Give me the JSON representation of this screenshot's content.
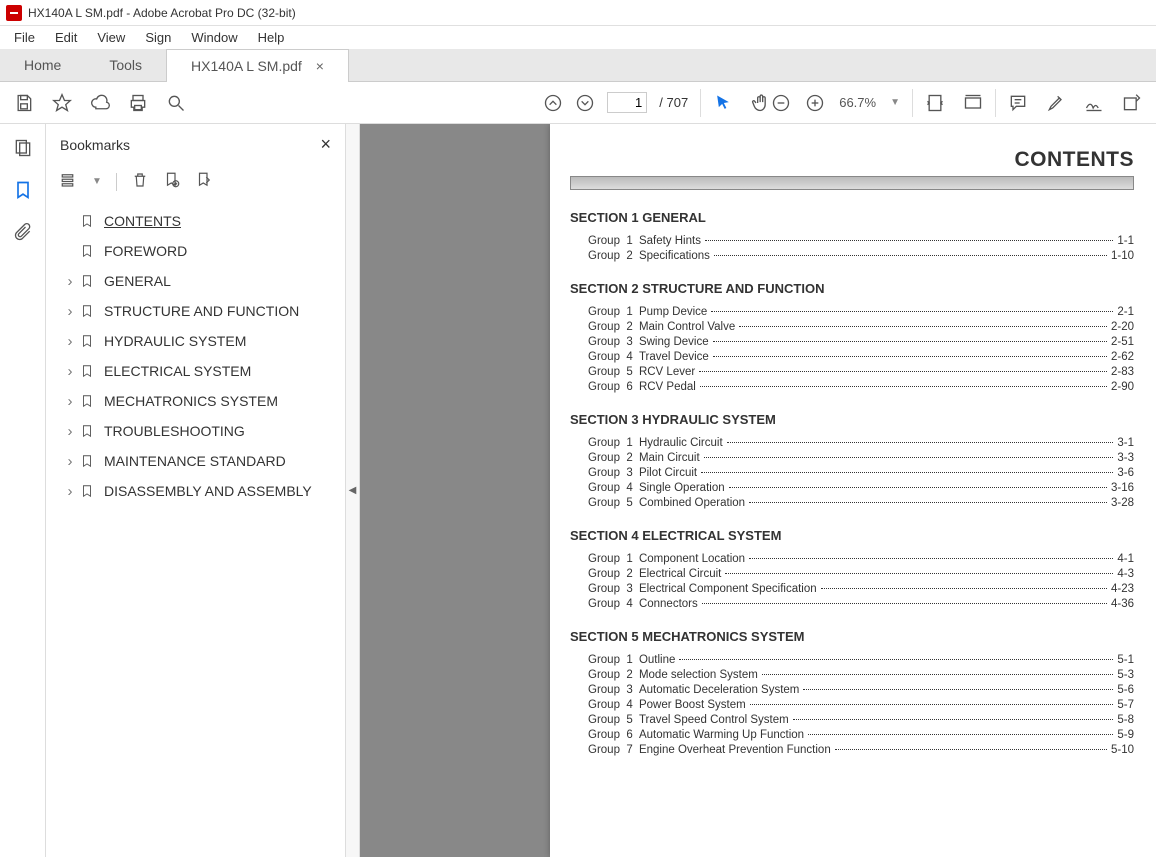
{
  "window": {
    "title": "HX140A L SM.pdf - Adobe Acrobat Pro DC (32-bit)"
  },
  "menu": {
    "items": [
      "File",
      "Edit",
      "View",
      "Sign",
      "Window",
      "Help"
    ]
  },
  "tabs": {
    "home": "Home",
    "tools": "Tools",
    "doc": "HX140A L SM.pdf"
  },
  "toolbar": {
    "current_page": "1",
    "total_pages": "707",
    "zoom": "66.7%"
  },
  "sidepanel": {
    "title": "Bookmarks",
    "items": [
      {
        "label": "CONTENTS",
        "expandable": false,
        "selected": true
      },
      {
        "label": "FOREWORD",
        "expandable": false,
        "selected": false
      },
      {
        "label": "GENERAL",
        "expandable": true,
        "selected": false
      },
      {
        "label": "STRUCTURE AND FUNCTION",
        "expandable": true,
        "selected": false
      },
      {
        "label": "HYDRAULIC SYSTEM",
        "expandable": true,
        "selected": false
      },
      {
        "label": "ELECTRICAL SYSTEM",
        "expandable": true,
        "selected": false
      },
      {
        "label": "MECHATRONICS SYSTEM",
        "expandable": true,
        "selected": false
      },
      {
        "label": "TROUBLESHOOTING",
        "expandable": true,
        "selected": false
      },
      {
        "label": "MAINTENANCE STANDARD",
        "expandable": true,
        "selected": false
      },
      {
        "label": "DISASSEMBLY AND ASSEMBLY",
        "expandable": true,
        "selected": false
      }
    ]
  },
  "doc": {
    "title": "CONTENTS",
    "sections": [
      {
        "num": "1",
        "name": "GENERAL",
        "groups": [
          {
            "n": "1",
            "name": "Safety Hints",
            "page": "1-1"
          },
          {
            "n": "2",
            "name": "Specifications",
            "page": "1-10"
          }
        ]
      },
      {
        "num": "2",
        "name": "STRUCTURE AND FUNCTION",
        "groups": [
          {
            "n": "1",
            "name": "Pump Device",
            "page": "2-1"
          },
          {
            "n": "2",
            "name": "Main Control Valve",
            "page": "2-20"
          },
          {
            "n": "3",
            "name": "Swing Device",
            "page": "2-51"
          },
          {
            "n": "4",
            "name": "Travel Device",
            "page": "2-62"
          },
          {
            "n": "5",
            "name": "RCV Lever",
            "page": "2-83"
          },
          {
            "n": "6",
            "name": "RCV Pedal",
            "page": "2-90"
          }
        ]
      },
      {
        "num": "3",
        "name": "HYDRAULIC SYSTEM",
        "groups": [
          {
            "n": "1",
            "name": "Hydraulic Circuit",
            "page": "3-1"
          },
          {
            "n": "2",
            "name": "Main Circuit",
            "page": "3-3"
          },
          {
            "n": "3",
            "name": "Pilot Circuit",
            "page": "3-6"
          },
          {
            "n": "4",
            "name": "Single Operation",
            "page": "3-16"
          },
          {
            "n": "5",
            "name": "Combined Operation",
            "page": "3-28"
          }
        ]
      },
      {
        "num": "4",
        "name": "ELECTRICAL SYSTEM",
        "groups": [
          {
            "n": "1",
            "name": "Component Location",
            "page": "4-1"
          },
          {
            "n": "2",
            "name": "Electrical Circuit",
            "page": "4-3"
          },
          {
            "n": "3",
            "name": "Electrical Component Specification",
            "page": "4-23"
          },
          {
            "n": "4",
            "name": "Connectors",
            "page": "4-36"
          }
        ]
      },
      {
        "num": "5",
        "name": "MECHATRONICS SYSTEM",
        "groups": [
          {
            "n": "1",
            "name": "Outline",
            "page": "5-1"
          },
          {
            "n": "2",
            "name": "Mode selection System",
            "page": "5-3"
          },
          {
            "n": "3",
            "name": "Automatic Deceleration System",
            "page": "5-6"
          },
          {
            "n": "4",
            "name": "Power Boost System",
            "page": "5-7"
          },
          {
            "n": "5",
            "name": "Travel Speed Control System",
            "page": "5-8"
          },
          {
            "n": "6",
            "name": "Automatic Warming Up Function",
            "page": "5-9"
          },
          {
            "n": "7",
            "name": "Engine Overheat Prevention Function",
            "page": "5-10"
          }
        ]
      }
    ]
  }
}
